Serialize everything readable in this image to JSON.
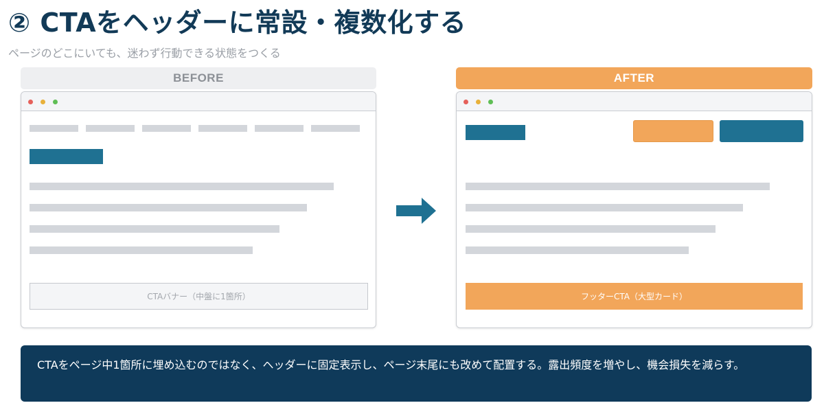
{
  "header": {
    "title": "② CTAをヘッダーに常設・複数化する",
    "subtitle": "ページのどこにいても、迷わず行動できる状態をつくる"
  },
  "before": {
    "label": "BEFORE",
    "cta_banner_label": "CTAバナー（中盤に1箇所）"
  },
  "after": {
    "label": "AFTER",
    "footer_cta_label": "フッターCTA（大型カード）"
  },
  "note": {
    "text": "CTAをページ中1箇所に埋め込むのではなく、ヘッダーに固定表示し、ページ末尾にも改めて配置する。露出頻度を増やし、機会損失を減らす。"
  },
  "colors": {
    "title": "#123a57",
    "accent_blue": "#1f7192",
    "accent_orange": "#f2a65a",
    "placeholder_gray": "#d3d6db",
    "note_background": "#0f3a5a"
  },
  "icons": [
    "right-arrow-icon"
  ]
}
